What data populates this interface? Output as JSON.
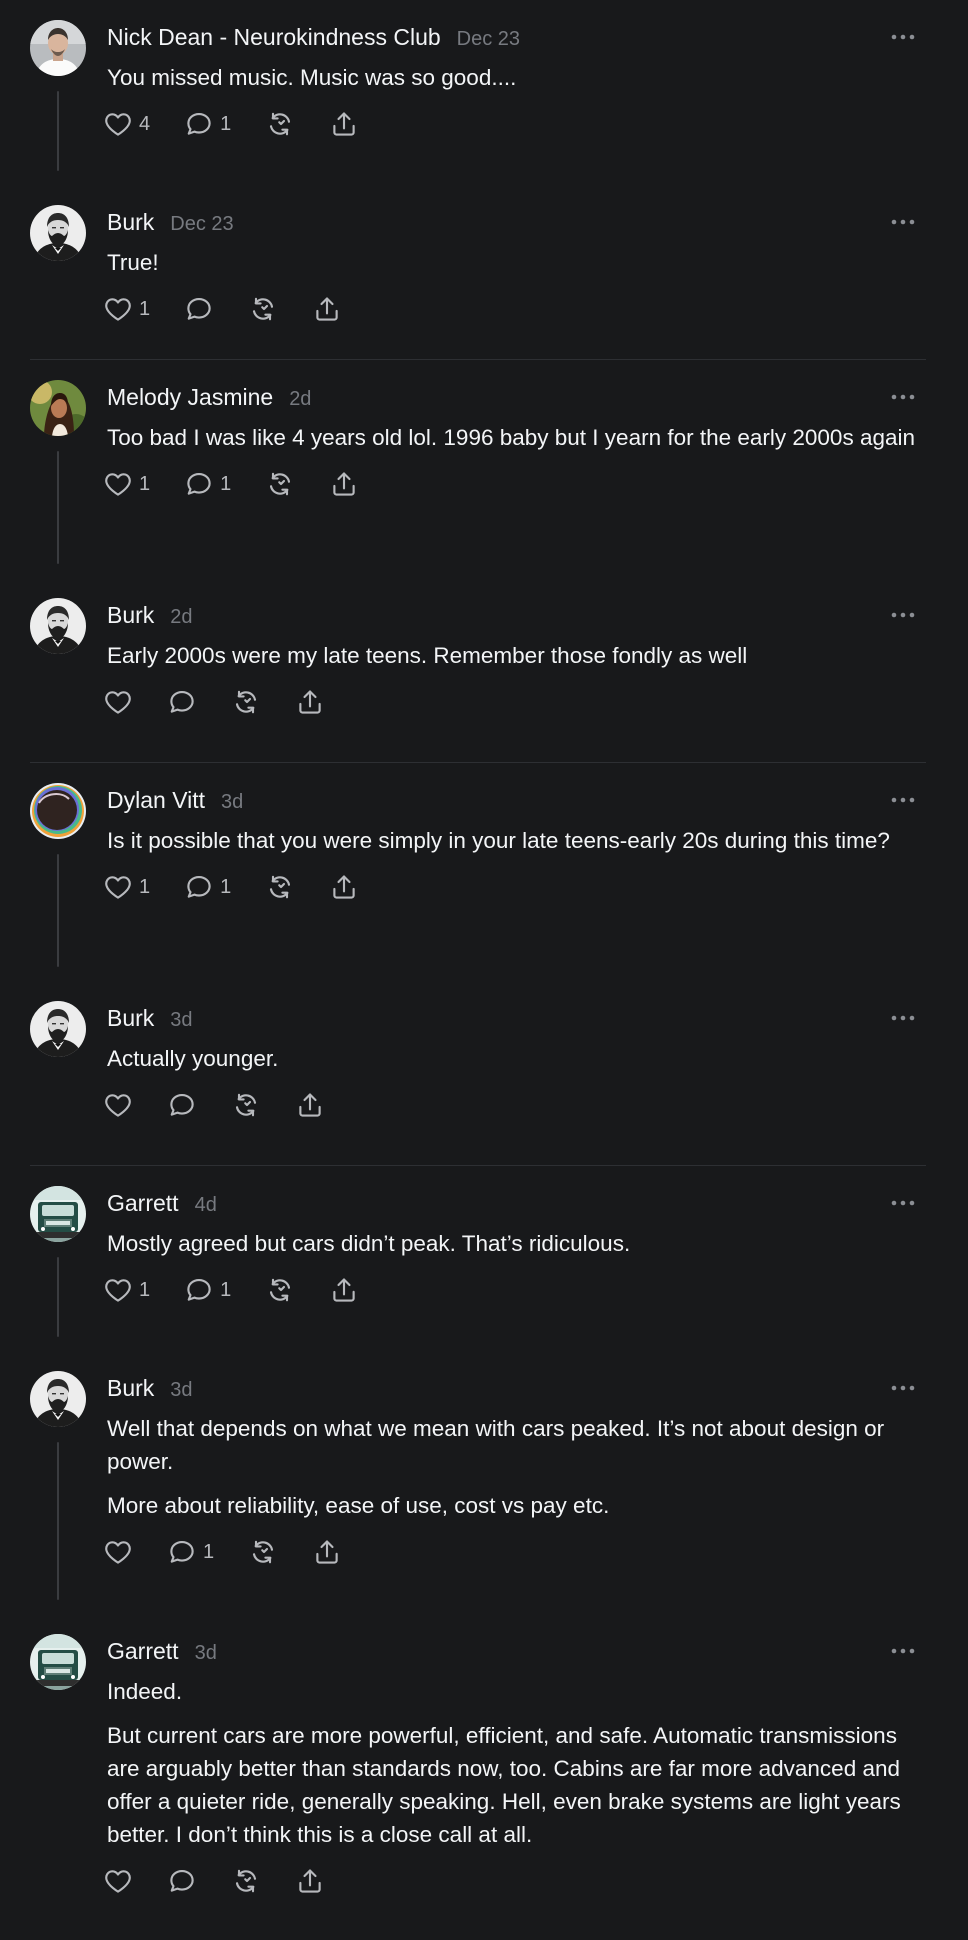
{
  "posts": [
    {
      "author": "Nick Dean - Neurokindness Club",
      "time": "Dec 23",
      "avatar": "nick",
      "paragraphs": [
        "You missed music. Music was so good...."
      ],
      "likes": "4",
      "replies": "1",
      "thread": true,
      "divider": false,
      "height": 185
    },
    {
      "author": "Burk",
      "time": "Dec 23",
      "avatar": "burk",
      "paragraphs": [
        "True!"
      ],
      "likes": "1",
      "replies": "",
      "thread": false,
      "divider": true,
      "height": 175
    },
    {
      "author": "Melody Jasmine",
      "time": "2d",
      "avatar": "melody",
      "paragraphs": [
        "Too bad I was like 4 years old lol. 1996 baby but I yearn for the early 2000s again"
      ],
      "likes": "1",
      "replies": "1",
      "thread": true,
      "divider": false,
      "height": 218
    },
    {
      "author": "Burk",
      "time": "2d",
      "avatar": "burk",
      "paragraphs": [
        "Early 2000s were my late teens. Remember those fondly as well"
      ],
      "likes": "",
      "replies": "",
      "thread": false,
      "divider": true,
      "height": 185
    },
    {
      "author": "Dylan Vitt",
      "time": "3d",
      "avatar": "dylan",
      "paragraphs": [
        "Is it possible that you were simply in your late teens-early 20s during this time?"
      ],
      "likes": "1",
      "replies": "1",
      "thread": true,
      "divider": false,
      "height": 218
    },
    {
      "author": "Burk",
      "time": "3d",
      "avatar": "burk",
      "paragraphs": [
        "Actually younger."
      ],
      "likes": "",
      "replies": "",
      "thread": false,
      "divider": true,
      "height": 185
    },
    {
      "author": "Garrett",
      "time": "4d",
      "avatar": "garrett",
      "paragraphs": [
        "Mostly agreed but cars didn’t peak. That’s ridiculous."
      ],
      "likes": "1",
      "replies": "1",
      "thread": true,
      "divider": false,
      "height": 185
    },
    {
      "author": "Burk",
      "time": "3d",
      "avatar": "burk",
      "paragraphs": [
        "Well that depends on what we mean with cars peaked. It’s not about design or power.",
        "More about reliability, ease of use, cost vs pay etc."
      ],
      "likes": "",
      "replies": "1",
      "thread": true,
      "divider": false,
      "height": 263
    },
    {
      "author": "Garrett",
      "time": "3d",
      "avatar": "garrett",
      "paragraphs": [
        "Indeed.",
        "But current cars are more powerful, efficient, and safe. Automatic transmissions are arguably better than standards now, too. Cabins are far more advanced and offer a quieter ride, generally speaking. Hell, even brake systems are light years better. I don’t think this is a close call at all."
      ],
      "likes": "",
      "replies": "",
      "thread": false,
      "divider": false,
      "height": 300
    }
  ]
}
